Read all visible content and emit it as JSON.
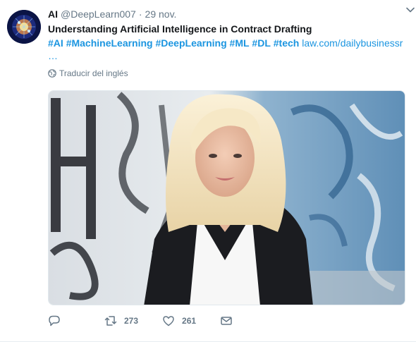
{
  "tweet": {
    "display_name": "AI",
    "handle": "@DeepLearn007",
    "separator": "·",
    "timestamp": "29 nov.",
    "title": "Understanding Artificial Intelligence in Contract Drafting",
    "hashtags": [
      "#AI",
      "#MachineLearning",
      "#DeepLearning",
      "#ML",
      "#DL",
      "#tech"
    ],
    "link_text": "law.com/dailybusinessr",
    "ellipsis": "…",
    "translate_label": "Traducir del inglés"
  },
  "actions": {
    "reply_count": "",
    "retweet_count": "273",
    "like_count": "261"
  },
  "icons": {
    "avatar": "ai-brain-avatar",
    "caret": "chevron-down-icon",
    "globe": "globe-icon",
    "reply": "reply-icon",
    "retweet": "retweet-icon",
    "like": "heart-icon",
    "message": "envelope-icon"
  },
  "colors": {
    "accent": "#1b95e0",
    "muted": "#657786",
    "text": "#14171a"
  }
}
